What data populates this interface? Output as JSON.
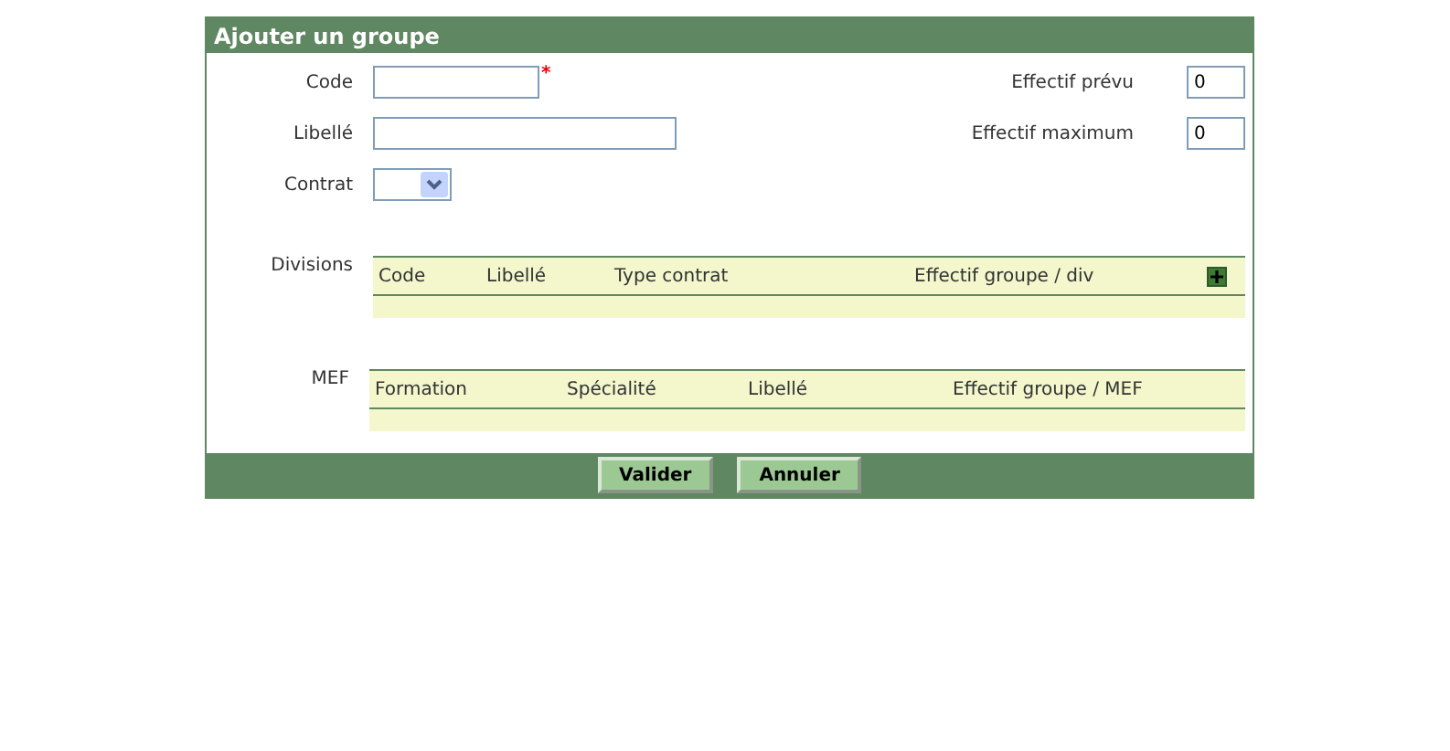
{
  "dialog": {
    "title": "Ajouter un groupe"
  },
  "fields_left": [
    {
      "label": "Code",
      "kind": "short",
      "required_mark": "*"
    },
    {
      "label": "Libellé",
      "kind": "long"
    },
    {
      "label": "Contrat",
      "kind": "select"
    }
  ],
  "fields_right": [
    {
      "label": "Effectif prévu",
      "value": "0"
    },
    {
      "label": "Effectif maximum",
      "value": "0"
    }
  ],
  "tables": [
    {
      "label": "Divisions",
      "columns": [
        "Code",
        "Libellé",
        "Type contrat",
        "Effectif groupe / div"
      ],
      "add_button": true
    },
    {
      "label": "MEF",
      "columns": [
        "Formation",
        "Spécialité",
        "Libellé",
        "Effectif groupe / MEF"
      ],
      "add_button": false
    }
  ],
  "buttons": [
    "Valider",
    "Annuler"
  ]
}
